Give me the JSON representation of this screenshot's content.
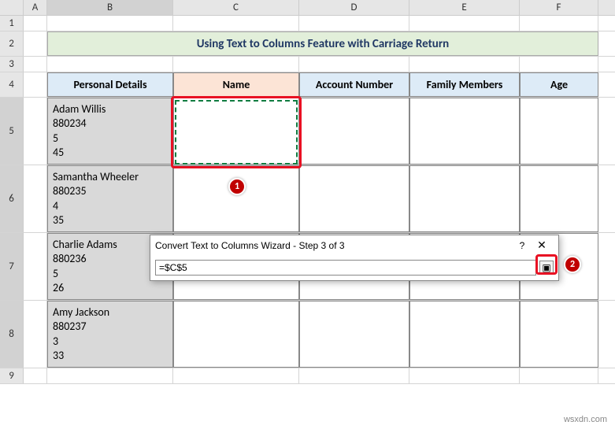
{
  "columns": {
    "A": "A",
    "B": "B",
    "C": "C",
    "D": "D",
    "E": "E",
    "F": "F"
  },
  "rows": {
    "r1": "1",
    "r2": "2",
    "r3": "3",
    "r4": "4",
    "r5": "5",
    "r6": "6",
    "r7": "7",
    "r8": "8",
    "r9": "9"
  },
  "title": "Using Text to Columns Feature with Carriage Return",
  "headers": {
    "personal": "Personal Details",
    "name": "Name",
    "account": "Account Number",
    "family": "Family Members",
    "age": "Age"
  },
  "data": [
    {
      "l1": "Adam Willis",
      "l2": "880234",
      "l3": "5",
      "l4": "45"
    },
    {
      "l1": "Samantha Wheeler",
      "l2": "880235",
      "l3": "4",
      "l4": "35"
    },
    {
      "l1": "Charlie Adams",
      "l2": "880236",
      "l3": "5",
      "l4": "26"
    },
    {
      "l1": "Amy Jackson",
      "l2": "880237",
      "l3": "3",
      "l4": "33"
    }
  ],
  "dialog": {
    "title": "Convert Text to Columns Wizard - Step 3 of 3",
    "help": "?",
    "close": "✕",
    "value": "=$C$5",
    "collapse": "▣"
  },
  "callouts": {
    "c1": "1",
    "c2": "2"
  },
  "watermark": "wsxdn.com"
}
